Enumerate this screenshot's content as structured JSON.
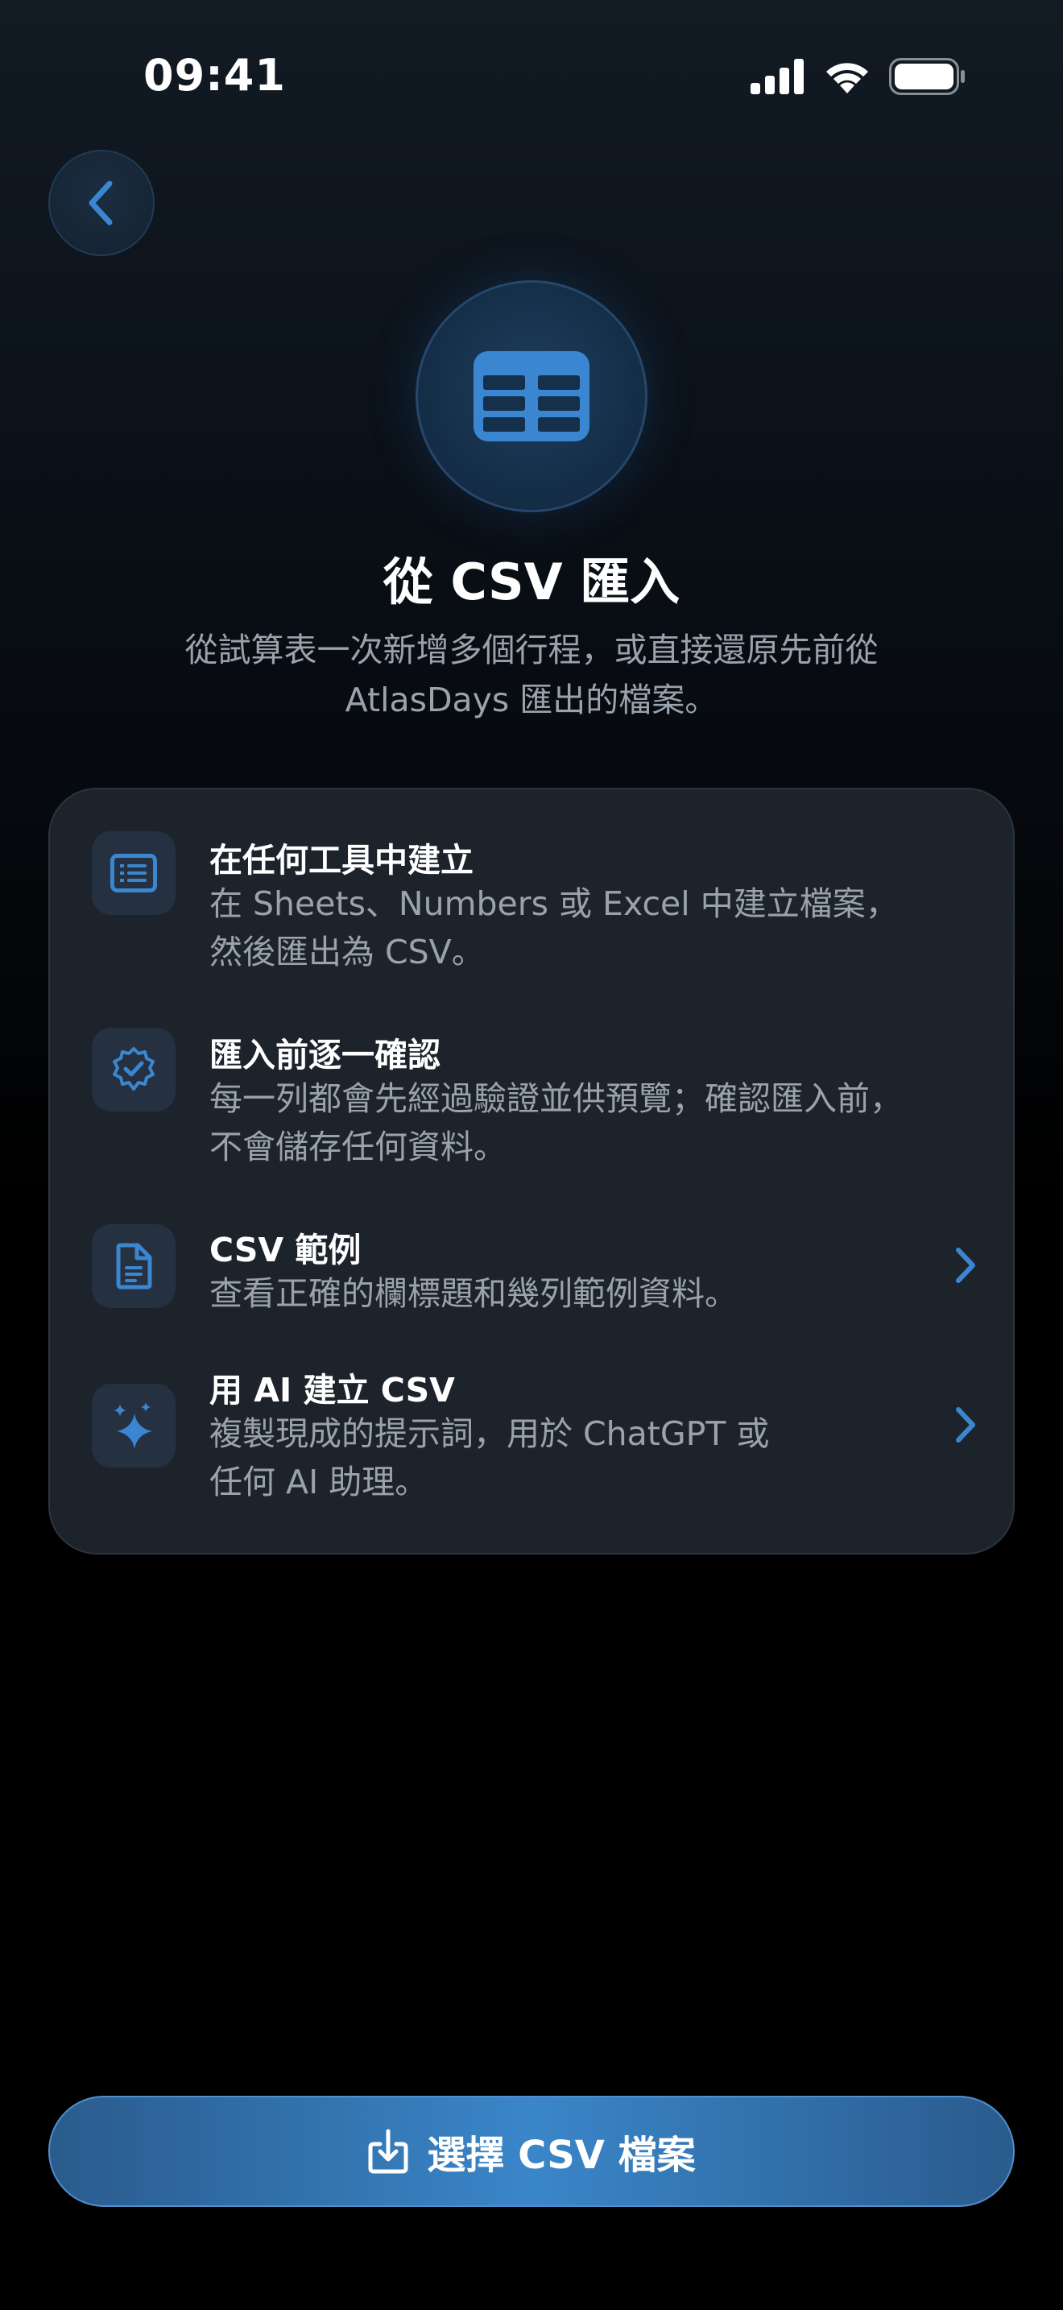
{
  "status_bar": {
    "time": "09:41"
  },
  "header": {
    "title": "從 CSV 匯入",
    "subtitle_line1": "從試算表一次新增多個行程，或直接還原先前從",
    "subtitle_line2": "AtlasDays 匯出的檔案。"
  },
  "card": {
    "items": [
      {
        "icon": "list-document-icon",
        "title": "在任何工具中建立",
        "desc_lines": [
          "在 Sheets、Numbers 或 Excel 中建立檔案，",
          "然後匯出為 CSV。"
        ]
      },
      {
        "icon": "verified-badge-icon",
        "title": "匯入前逐一確認",
        "desc_lines": [
          "每一列都會先經過驗證並供預覽；確認匯入前，",
          "不會儲存任何資料。"
        ]
      },
      {
        "icon": "document-icon",
        "title": "CSV 範例",
        "desc_lines": [
          "查看正確的欄標題和幾列範例資料。"
        ]
      },
      {
        "icon": "sparkles-icon",
        "title": "用 AI 建立 CSV",
        "desc_lines": [
          "複製現成的提示詞，用於 ChatGPT 或",
          "任何 AI 助理。"
        ]
      }
    ]
  },
  "primary_button": {
    "label": "選擇 CSV 檔案"
  },
  "colors": {
    "accent": "#3b86d1",
    "card_bg": "#1d232b",
    "secondary_text": "#9aa3ad"
  }
}
